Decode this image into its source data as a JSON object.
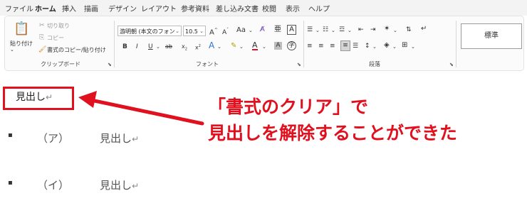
{
  "tabs": [
    "ファイル",
    "ホーム",
    "挿入",
    "描画",
    "デザイン",
    "レイアウト",
    "参考資料",
    "差し込み文書",
    "校閲",
    "表示",
    "ヘルプ"
  ],
  "clipboard": {
    "paste_label": "貼り付け",
    "cut_label": "切り取り",
    "copy_label": "コピー",
    "format_painter_label": "書式のコピー/貼り付け",
    "group_label": "クリップボード"
  },
  "font": {
    "font_name": "游明朝 (本文のフォン",
    "font_size": "10.5",
    "change_case": "Aa",
    "group_label": "フォント"
  },
  "paragraph": {
    "group_label": "段落"
  },
  "styles": {
    "standard": "標準"
  },
  "document": {
    "heading": "見出し",
    "items": [
      {
        "label": "（ア）",
        "text": "見出し"
      },
      {
        "label": "（イ）",
        "text": "見出し"
      }
    ],
    "paragraph_mark": "↵"
  },
  "annotation": {
    "line1": "「書式のクリア」で",
    "line2": "見出しを解除することができた",
    "color": "#e0101e"
  }
}
